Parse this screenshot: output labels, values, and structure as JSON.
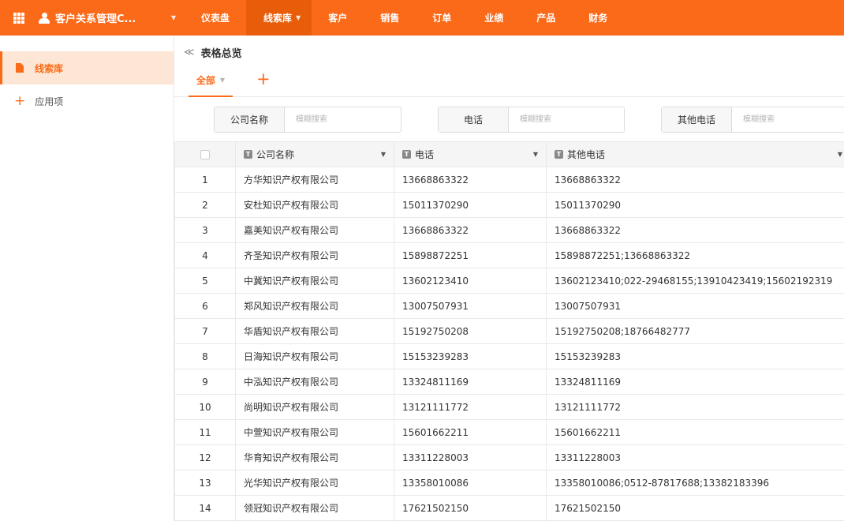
{
  "app": {
    "title": "客户关系管理C..."
  },
  "nav": [
    {
      "label": "仪表盘",
      "active": false
    },
    {
      "label": "线索库",
      "active": true
    },
    {
      "label": "客户",
      "active": false
    },
    {
      "label": "销售",
      "active": false
    },
    {
      "label": "订单",
      "active": false
    },
    {
      "label": "业绩",
      "active": false
    },
    {
      "label": "产品",
      "active": false
    },
    {
      "label": "财务",
      "active": false
    }
  ],
  "sidebar": {
    "items": [
      {
        "label": "线索库"
      },
      {
        "label": "应用项"
      }
    ]
  },
  "page": {
    "title": "表格总览",
    "view_tab": "全部"
  },
  "filters": [
    {
      "label": "公司名称",
      "placeholder": "模糊搜索"
    },
    {
      "label": "电话",
      "placeholder": "模糊搜索"
    },
    {
      "label": "其他电话",
      "placeholder": "模糊搜索"
    }
  ],
  "table": {
    "columns": [
      "公司名称",
      "电话",
      "其他电话"
    ],
    "rows": [
      [
        "1",
        "方华知识产权有限公司",
        "13668863322",
        "13668863322"
      ],
      [
        "2",
        "安杜知识产权有限公司",
        "15011370290",
        "15011370290"
      ],
      [
        "3",
        "嘉美知识产权有限公司",
        "13668863322",
        "13668863322"
      ],
      [
        "4",
        "齐圣知识产权有限公司",
        "15898872251",
        "15898872251;13668863322"
      ],
      [
        "5",
        "中冀知识产权有限公司",
        "13602123410",
        "13602123410;022-29468155;13910423419;15602192319"
      ],
      [
        "6",
        "郑风知识产权有限公司",
        "13007507931",
        "13007507931"
      ],
      [
        "7",
        "华盾知识产权有限公司",
        "15192750208",
        "15192750208;18766482777"
      ],
      [
        "8",
        "日海知识产权有限公司",
        "15153239283",
        "15153239283"
      ],
      [
        "9",
        "中泓知识产权有限公司",
        "13324811169",
        "13324811169"
      ],
      [
        "10",
        "尚明知识产权有限公司",
        "13121111772",
        "13121111772"
      ],
      [
        "11",
        "中萱知识产权有限公司",
        "15601662211",
        "15601662211"
      ],
      [
        "12",
        "华育知识产权有限公司",
        "13311228003",
        "13311228003"
      ],
      [
        "13",
        "光华知识产权有限公司",
        "13358010086",
        "13358010086;0512-87817688;13382183396"
      ],
      [
        "14",
        "领冠知识产权有限公司",
        "17621502150",
        "17621502150"
      ]
    ]
  },
  "colors": {
    "accent": "#fb6a18",
    "accent_dark": "#e85d0a",
    "sidebar_active_bg": "#fde6d5"
  }
}
